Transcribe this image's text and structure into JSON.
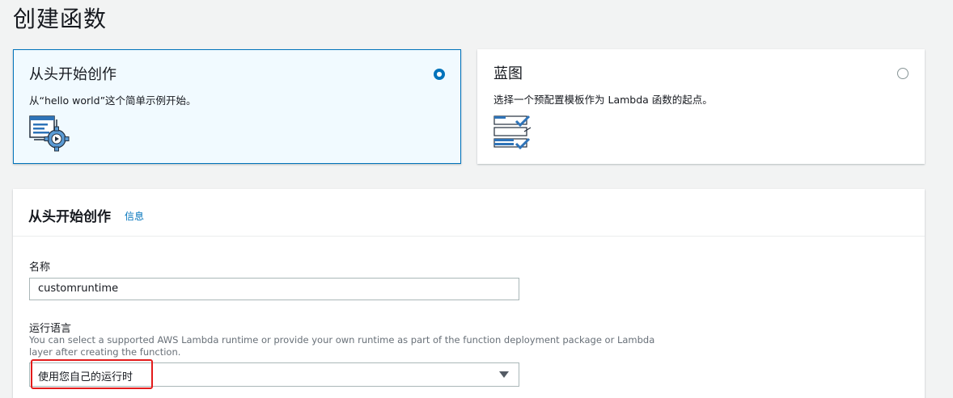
{
  "page": {
    "title": "创建函数"
  },
  "options": {
    "scratch": {
      "title": "从头开始创作",
      "description": "从“hello world”这个简单示例开始。",
      "icon": "code-gear-icon",
      "selected": true
    },
    "blueprint": {
      "title": "蓝图",
      "description": "选择一个预配置模板作为 Lambda 函数的起点。",
      "icon": "checklist-icon",
      "selected": false
    }
  },
  "form": {
    "title": "从头开始创作",
    "info_link": "信息",
    "name_label": "名称",
    "name_value": "customruntime",
    "runtime_label": "运行语言",
    "runtime_description": "You can select a supported AWS Lambda runtime or provide your own runtime as part of the function deployment package or Lambda layer after creating the function.",
    "runtime_value": "使用您自己的运行时"
  },
  "colors": {
    "accent": "#0073bb",
    "highlight": "#e31b1b",
    "selected_bg": "#f1faff"
  }
}
